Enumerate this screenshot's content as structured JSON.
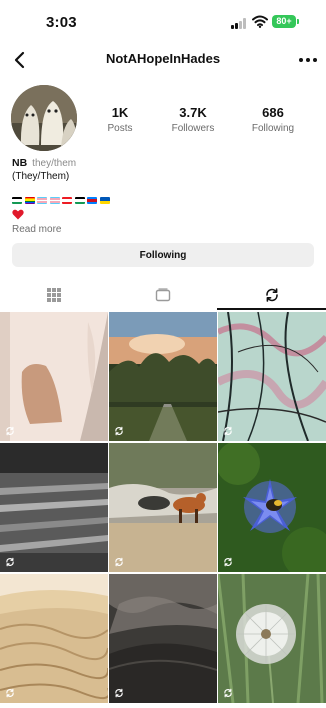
{
  "status_bar": {
    "time": "3:03",
    "battery": "80+",
    "icons": [
      "signal-icon",
      "wifi-icon",
      "battery-icon"
    ]
  },
  "header": {
    "username": "NotAHopeInHades",
    "back_icon": "chevron-left-icon",
    "more_icon": "more-horizontal-icon"
  },
  "profile": {
    "stats": [
      {
        "value": "1K",
        "label": "Posts"
      },
      {
        "value": "3.7K",
        "label": "Followers"
      },
      {
        "value": "686",
        "label": "Following"
      }
    ],
    "name": "NB",
    "pronouns": "they/them",
    "bio_line": "(They/Them)",
    "bio_flags": [
      "palestine-flag",
      "rainbow-flag",
      "transgender-flag",
      "transgender-flag",
      "lebanon-flag",
      "palestine-flag",
      "congo-flag",
      "ukraine-flag"
    ],
    "bio_heart": "heart-icon",
    "read_more": "Read more"
  },
  "actions": {
    "following_button": "Following"
  },
  "tabs": [
    {
      "name": "grid-icon",
      "active": false
    },
    {
      "name": "reels-icon",
      "active": false
    },
    {
      "name": "reposts-icon",
      "active": true
    }
  ],
  "grid": {
    "badge_icon": "repost-icon",
    "tiles": [
      "abstract shadows on a pale wall",
      "sunset sky over a forest path",
      "green and pink abstract tangled pattern",
      "black and white railway tracks",
      "fox standing on a rocky shoreline",
      "blue wildflower with a bee",
      "sand dunes with ripples",
      "dark dramatic clouds over hills",
      "dandelion seed head in grass"
    ]
  },
  "colors": {
    "accent_battery": "#34c759",
    "button_bg": "#efefef",
    "muted_text": "#6b6b6b"
  }
}
